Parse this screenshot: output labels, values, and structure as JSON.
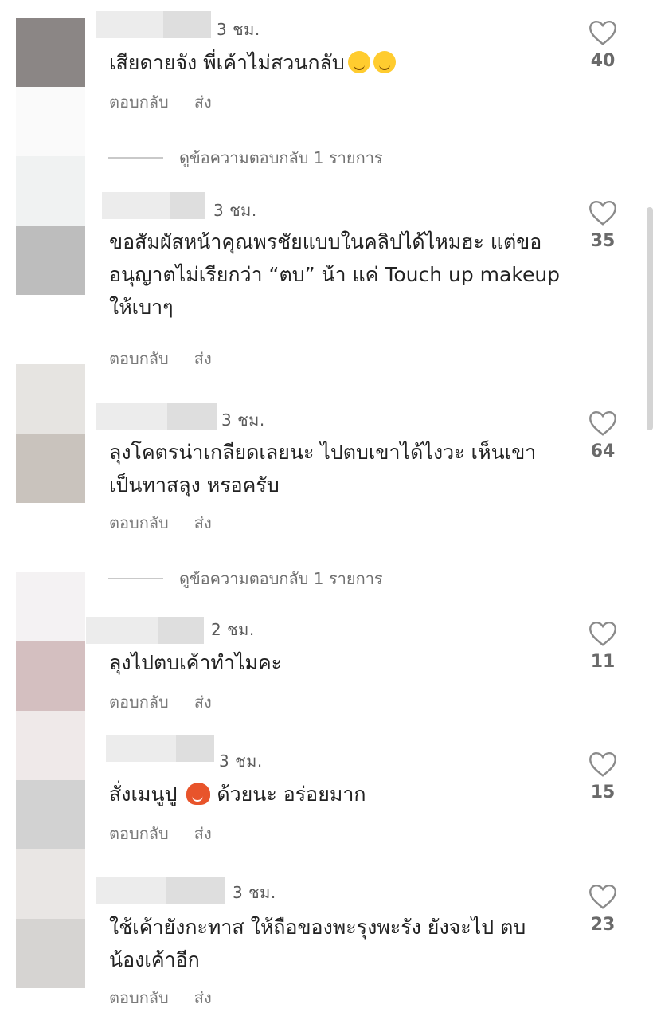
{
  "comments": [
    {
      "time": "3 ชม.",
      "text": "เสียดายจัง  พี่เค้าไม่สวนกลับ",
      "emoji": "crying-face-icon",
      "likes": "40"
    },
    {
      "time": "3 ชม.",
      "text": "ขอสัมผัสหน้าคุณพรชัยแบบในคลิปได้ไหมฮะ แต่ขออนุญาตไม่เรียกว่า “ตบ” น้า แค่ Touch up makeup ให้เบาๆ",
      "likes": "35"
    },
    {
      "time": "3 ชม.",
      "text": "ลุงโคตรน่าเกลียดเลยนะ ไปตบเขาได้ไงวะ เห็นเขาเป็นทาสลุง หรอครับ",
      "likes": "64"
    },
    {
      "time": "2 ชม.",
      "text": "ลุงไปตบเค้าทำไมคะ",
      "likes": "11"
    },
    {
      "time": "3 ชม.",
      "text_before": "สั่งเมนูปู",
      "text_after": " ด้วยนะ อร่อยมาก",
      "emoji": "crab-icon",
      "likes": "15"
    },
    {
      "time": "3 ชม.",
      "text": "ใช้เค้ายังกะทาส ให้ถือของพะรุงพะรัง ยังจะไป ตบน้องเค้าอีก",
      "likes": "23"
    }
  ],
  "actions": {
    "reply": "ตอบกลับ",
    "send": "ส่ง"
  },
  "view_replies": "ดูข้อความตอบกลับ 1 รายการ",
  "colors": {
    "avatar_1": "#8a8585",
    "avatar_2": "#b8b8b8",
    "avatar_3": "#c8c2bc",
    "avatar_4": "#d6c0c0",
    "avatar_5": "#d0d0d0",
    "avatar_6": "#dcdcdc"
  }
}
